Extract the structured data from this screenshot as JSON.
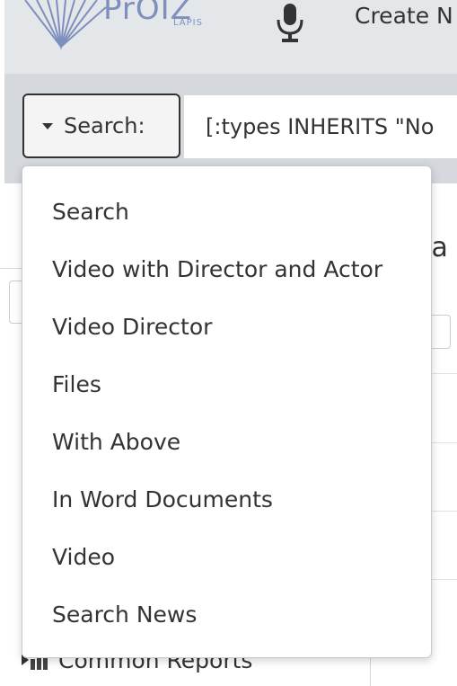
{
  "header": {
    "logo_text": "PrOIZ",
    "logo_sub": "LAPIS",
    "create_label": "Create N"
  },
  "search": {
    "dropdown_label": "Search:",
    "query_value": "[:types INHERITS \"No"
  },
  "background": {
    "heading_fragment": "ea",
    "tree_item_label": "Common Reports"
  },
  "dropdown": {
    "items": [
      "Search",
      "Video with Director and Actor",
      "Video Director",
      "Files",
      "With Above",
      "In Word Documents",
      "Video",
      "Search News"
    ]
  },
  "colors": {
    "topbar_bg": "#e4e7ea",
    "searchbar_bg": "#d5d9de",
    "logo_color": "#7e8fbd"
  }
}
